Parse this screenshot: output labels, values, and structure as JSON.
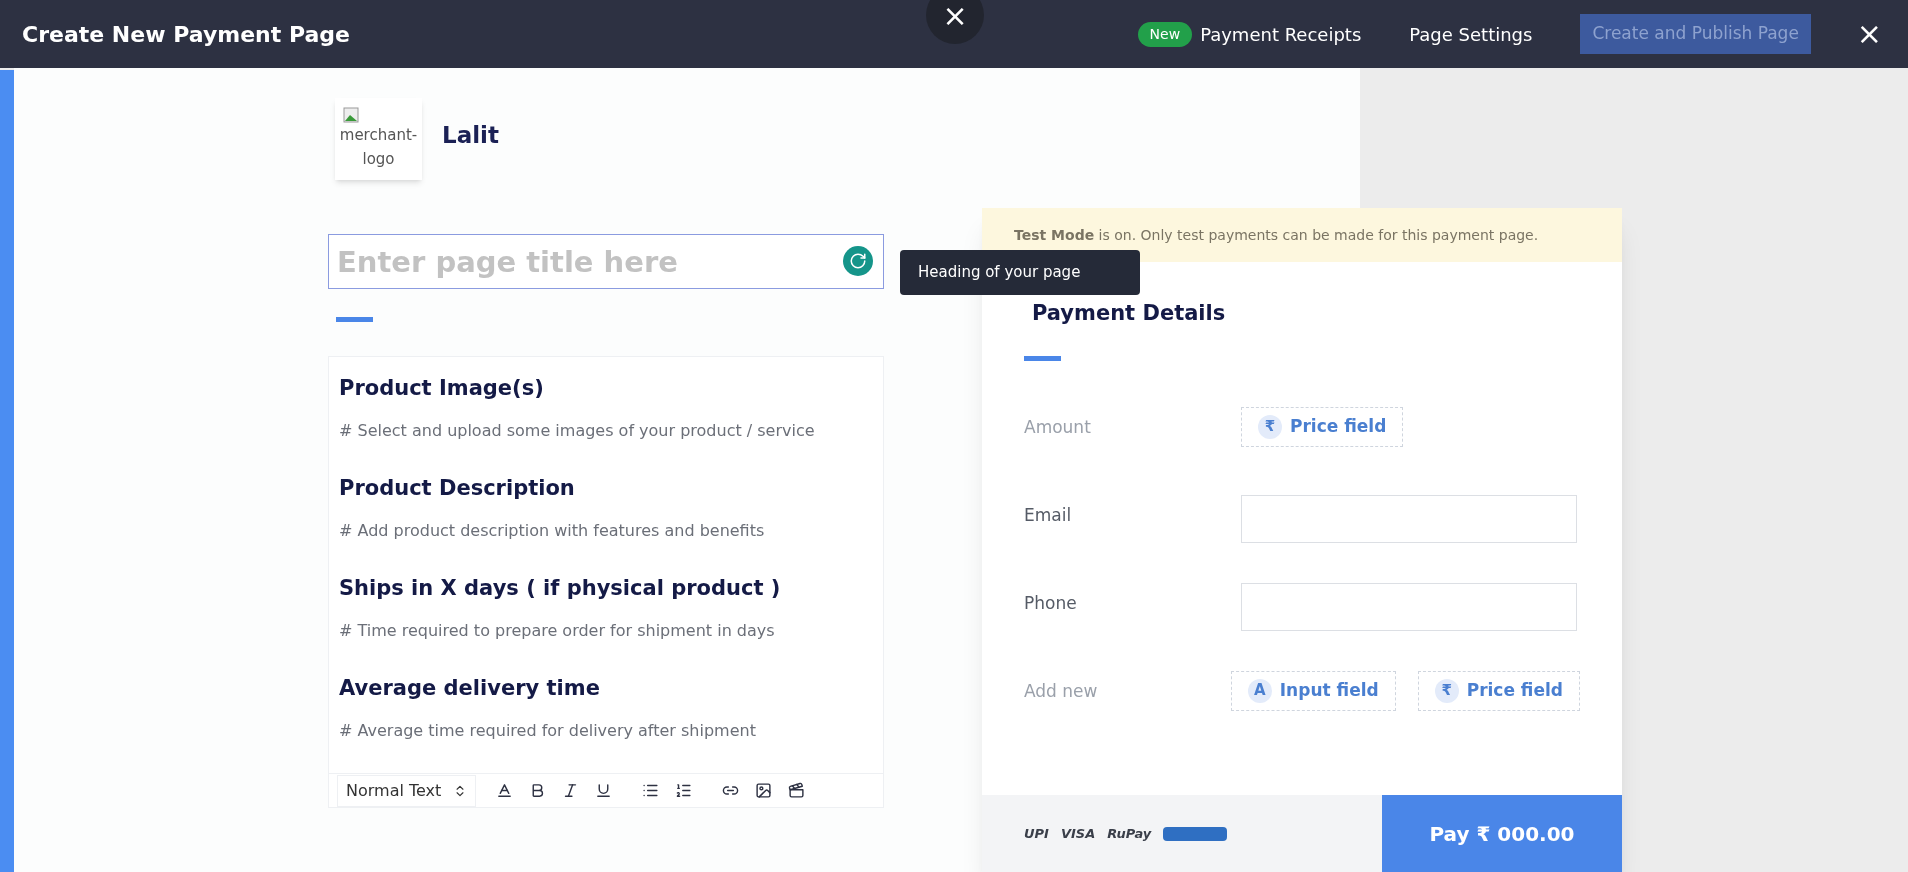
{
  "header": {
    "title": "Create New Payment Page",
    "close_center": "×",
    "badge": "New",
    "links": [
      "Payment Receipts",
      "Page Settings"
    ],
    "publish_button": {
      "label": "Create and Publish Page",
      "disabled": true
    },
    "close": "×"
  },
  "merchant": {
    "logo_alt": "merchant-logo",
    "name": "Lalit"
  },
  "title_field": {
    "placeholder": "Enter page title here"
  },
  "tooltip": "Heading of your page",
  "editor": {
    "sections": [
      {
        "heading": "Product Image(s)",
        "hint": "# Select and upload some images of your product / service"
      },
      {
        "heading": "Product Description",
        "hint": "# Add product description with features and benefits"
      },
      {
        "heading": "Ships in X days ( if physical product )",
        "hint": "# Time required to prepare order for shipment in days"
      },
      {
        "heading": "Average delivery time",
        "hint": "# Average time required for delivery after shipment"
      }
    ],
    "format_select": "Normal Text"
  },
  "payment": {
    "test_mode": "**Test Mode** is on. Only test payments can be made for this payment page.",
    "title": "Payment Details",
    "rows": [
      {
        "label": "Amount",
        "kind": "chips",
        "muted": true,
        "chips": [
          {
            "glyph": "₹",
            "label": "Price field"
          }
        ]
      },
      {
        "label": "Email",
        "kind": "input",
        "muted": false
      },
      {
        "label": "Phone",
        "kind": "input",
        "muted": false
      },
      {
        "label": "Add new",
        "kind": "chips",
        "muted": true,
        "chips": [
          {
            "glyph": "A",
            "label": "Input field"
          },
          {
            "glyph": "₹",
            "label": "Price field"
          }
        ]
      }
    ],
    "payment_logos": [
      "UPI",
      "VISA",
      "RuPay"
    ],
    "pay_button": "Pay  ₹ 000.00"
  }
}
